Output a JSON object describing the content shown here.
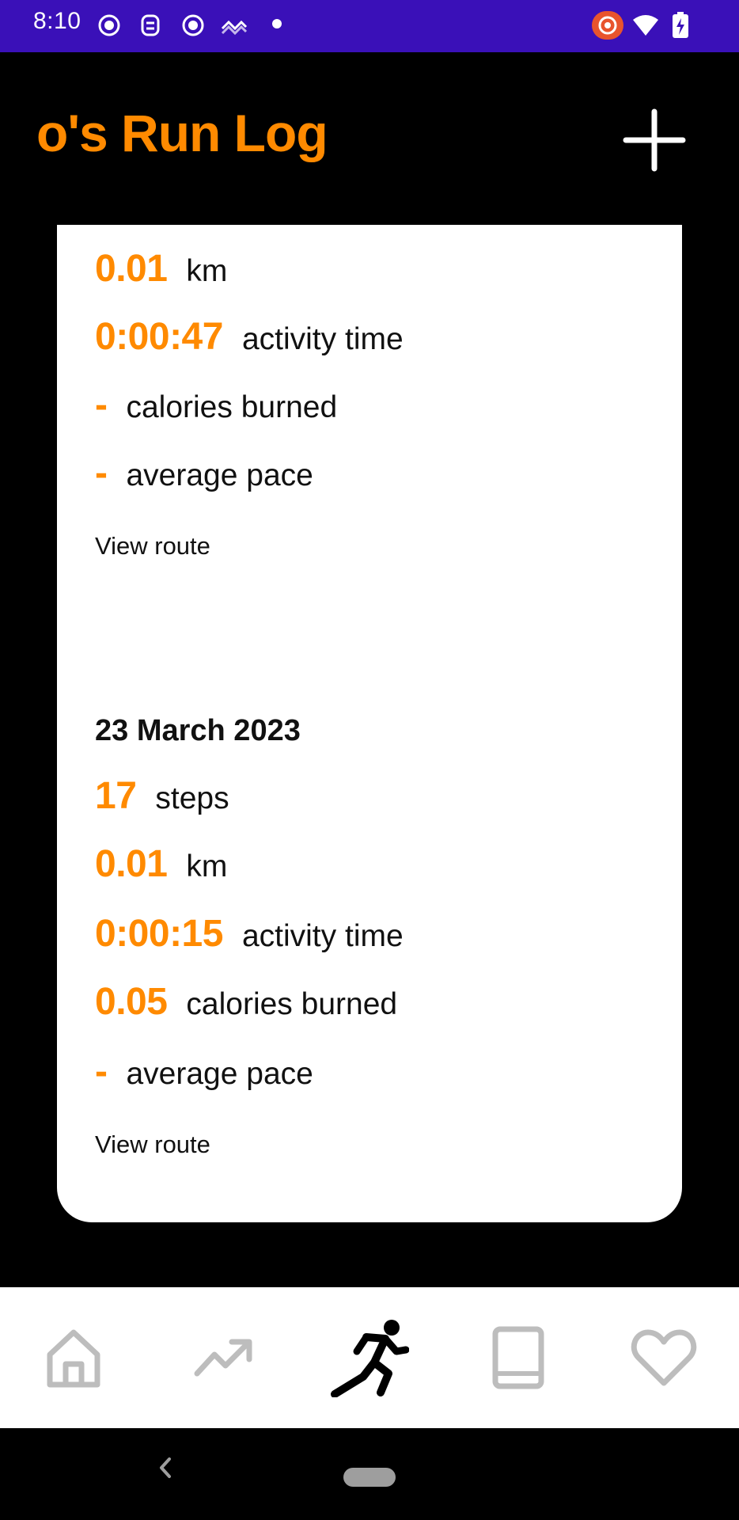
{
  "status_bar": {
    "time": "8:10",
    "background": "#3a10b8",
    "left_icons": [
      "record-icon",
      "face-icon",
      "record-icon",
      "wave-icon",
      "dot-icon"
    ],
    "right_icons": [
      "recording-badge-icon",
      "wifi-icon",
      "battery-charging-icon"
    ]
  },
  "header": {
    "title": "o's Run Log",
    "title_color": "#ff8a00",
    "add_icon": "plus-icon"
  },
  "entries": [
    {
      "date": "",
      "steps": null,
      "distance": {
        "value": "0.01",
        "label": "km"
      },
      "activity_time": {
        "value": "0:00:47",
        "label": "activity time"
      },
      "calories": {
        "value": "-",
        "label": "calories burned"
      },
      "pace": {
        "value": "-",
        "label": "average pace"
      },
      "link": "View route"
    },
    {
      "date": "23 March 2023",
      "steps": {
        "value": "17",
        "label": "steps"
      },
      "distance": {
        "value": "0.01",
        "label": "km"
      },
      "activity_time": {
        "value": "0:00:15",
        "label": "activity time"
      },
      "calories": {
        "value": "0.05",
        "label": "calories burned"
      },
      "pace": {
        "value": "-",
        "label": "average pace"
      },
      "link": "View route"
    }
  ],
  "bottom_nav": {
    "items": [
      {
        "icon": "home-icon",
        "active": false
      },
      {
        "icon": "trending-up-icon",
        "active": false
      },
      {
        "icon": "run-icon",
        "active": true
      },
      {
        "icon": "book-icon",
        "active": false
      },
      {
        "icon": "heart-icon",
        "active": false
      }
    ],
    "active_color": "#000000",
    "inactive_color": "#bdbdbd"
  },
  "system_nav": {
    "back_icon": "back-chevron-icon"
  }
}
